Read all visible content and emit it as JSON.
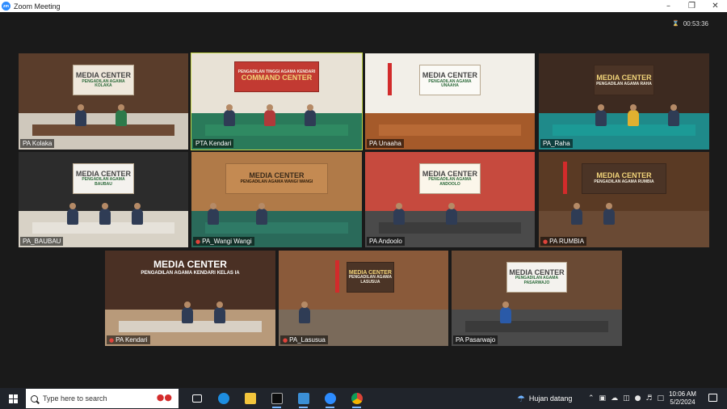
{
  "window": {
    "app_title": "Zoom Meeting",
    "logo_text": "zm",
    "controls": [
      "minimize-icon",
      "restore-icon",
      "close-icon"
    ]
  },
  "meeting": {
    "elapsed_time": "00:53:36",
    "timer_icon": "meeting-info-icon",
    "active_speaker_color": "#c6d84a"
  },
  "tiles": [
    {
      "name": "PA Kolaka",
      "muted": false,
      "sign_title": "MEDIA CENTER",
      "sign_sub": "PENGADILAN AGAMA KOLAKA"
    },
    {
      "name": "PTA Kendari",
      "muted": false,
      "sign_title": "COMMAND CENTER",
      "sign_sub": "PENGADILAN TINGGI AGAMA KENDARI"
    },
    {
      "name": "PA Unaaha",
      "muted": false,
      "sign_title": "MEDIA CENTER",
      "sign_sub": "PENGADILAN AGAMA UNAAHA"
    },
    {
      "name": "PA_Raha",
      "muted": false,
      "sign_title": "MEDIA CENTER",
      "sign_sub": "PENGADILAN AGAMA RAHA"
    },
    {
      "name": "PA_BAUBAU",
      "muted": false,
      "sign_title": "MEDIA CENTER",
      "sign_sub": "PENGADILAN AGAMA BAUBAU"
    },
    {
      "name": "PA_Wangi Wangi",
      "muted": true,
      "sign_title": "MEDIA CENTER",
      "sign_sub": "PENGADILAN AGAMA WANGI WANGI"
    },
    {
      "name": "PA Andoolo",
      "muted": false,
      "sign_title": "MEDIA CENTER",
      "sign_sub": "PENGADILAN AGAMA ANDOOLO"
    },
    {
      "name": "PA RUMBIA",
      "muted": true,
      "sign_title": "MEDIA CENTER",
      "sign_sub": "PENGADILAN AGAMA RUMBIA"
    },
    {
      "name": "PA Kendari",
      "muted": true,
      "sign_title": "MEDIA CENTER",
      "sign_sub": "PENGADILAN AGAMA KENDARI KELAS IA"
    },
    {
      "name": "PA_Lasusua",
      "muted": true,
      "sign_title": "MEDIA CENTER",
      "sign_sub": "PENGADILAN AGAMA LASUSUA"
    },
    {
      "name": "PA Pasarwajo",
      "muted": false,
      "sign_title": "MEDIA CENTER",
      "sign_sub": "PENGADILAN AGAMA PASARWAJO"
    }
  ],
  "taskbar": {
    "search_placeholder": "Type here to search",
    "weather_text": "Hujan datang",
    "time": "10:06 AM",
    "date": "5/2/2024",
    "pinned": [
      "task-view-icon",
      "edge-icon",
      "file-explorer-icon",
      "terminal-icon",
      "remote-desktop-icon",
      "zoom-icon",
      "chrome-icon"
    ]
  }
}
